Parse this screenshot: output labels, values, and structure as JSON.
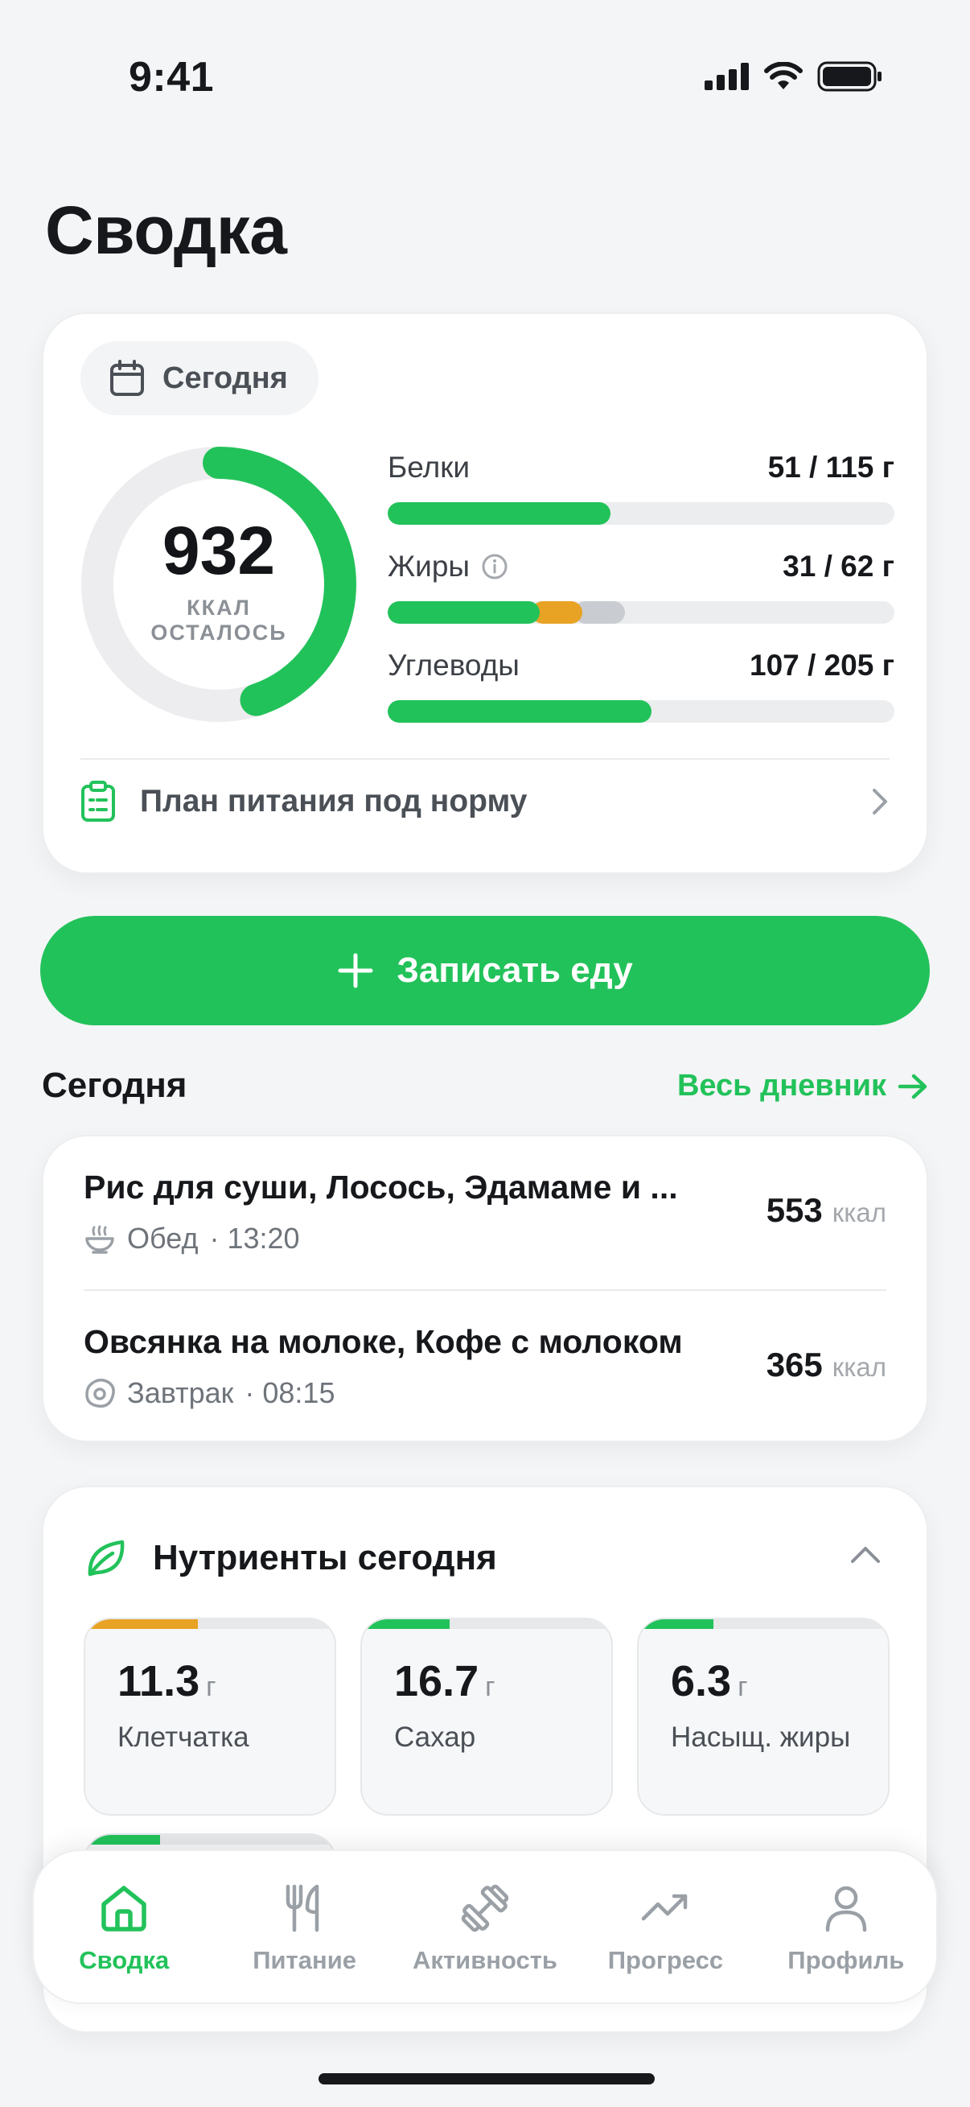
{
  "status_bar": {
    "time": "9:41"
  },
  "page_title": "Сводка",
  "summary": {
    "date_chip": "Сегодня",
    "calories_left": {
      "value": "932",
      "unit_line1": "ККАЛ",
      "unit_line2": "ОСТАЛОСЬ",
      "progress_fraction": 0.45
    },
    "macros": [
      {
        "name": "Белки",
        "value": "51 / 115 г",
        "segments": [
          {
            "fraction": 0.44,
            "color": "#22c25a"
          }
        ]
      },
      {
        "name": "Жиры",
        "value": "31 / 62 г",
        "has_info": true,
        "segments": [
          {
            "fraction": 0.3,
            "color": "#22c25a"
          },
          {
            "fraction": 0.1,
            "color": "#e8a324"
          },
          {
            "fraction": 0.1,
            "color": "#c9ccd0"
          }
        ]
      },
      {
        "name": "Углеводы",
        "value": "107 / 205 г",
        "segments": [
          {
            "fraction": 0.52,
            "color": "#22c25a"
          }
        ]
      }
    ],
    "plan_link": "План питания под норму"
  },
  "log_button": "Записать еду",
  "today": {
    "title": "Сегодня",
    "diary_link": "Весь дневник",
    "meals": [
      {
        "title": "Рис для суши, Лосось, Эдамаме и ...",
        "type": "Обед",
        "time": "· 13:20",
        "kcal": "553",
        "unit": "ккал"
      },
      {
        "title": "Овсянка на молоке, Кофе с молоком",
        "type": "Завтрак",
        "time": "· 08:15",
        "kcal": "365",
        "unit": "ккал"
      }
    ]
  },
  "nutrients": {
    "title": "Нутриенты сегодня",
    "items": [
      {
        "value": "11.3",
        "unit": "г",
        "label": "Клетчатка",
        "fill_fraction": 0.45,
        "color": "#e8a324"
      },
      {
        "value": "16.7",
        "unit": "г",
        "label": "Сахар",
        "fill_fraction": 0.35,
        "color": "#22c25a"
      },
      {
        "value": "6.3",
        "unit": "г",
        "label": "Насыщ. жиры",
        "fill_fraction": 0.3,
        "color": "#22c25a"
      }
    ]
  },
  "tabs": [
    {
      "label": "Сводка",
      "icon": "home-icon",
      "active": true
    },
    {
      "label": "Питание",
      "icon": "utensils-icon",
      "active": false
    },
    {
      "label": "Активность",
      "icon": "dumbbell-icon",
      "active": false
    },
    {
      "label": "Прогресс",
      "icon": "trend-icon",
      "active": false
    },
    {
      "label": "Профиль",
      "icon": "person-icon",
      "active": false
    }
  ],
  "colors": {
    "accent": "#22c25a",
    "warning": "#e8a324",
    "track": "#ecedef"
  }
}
